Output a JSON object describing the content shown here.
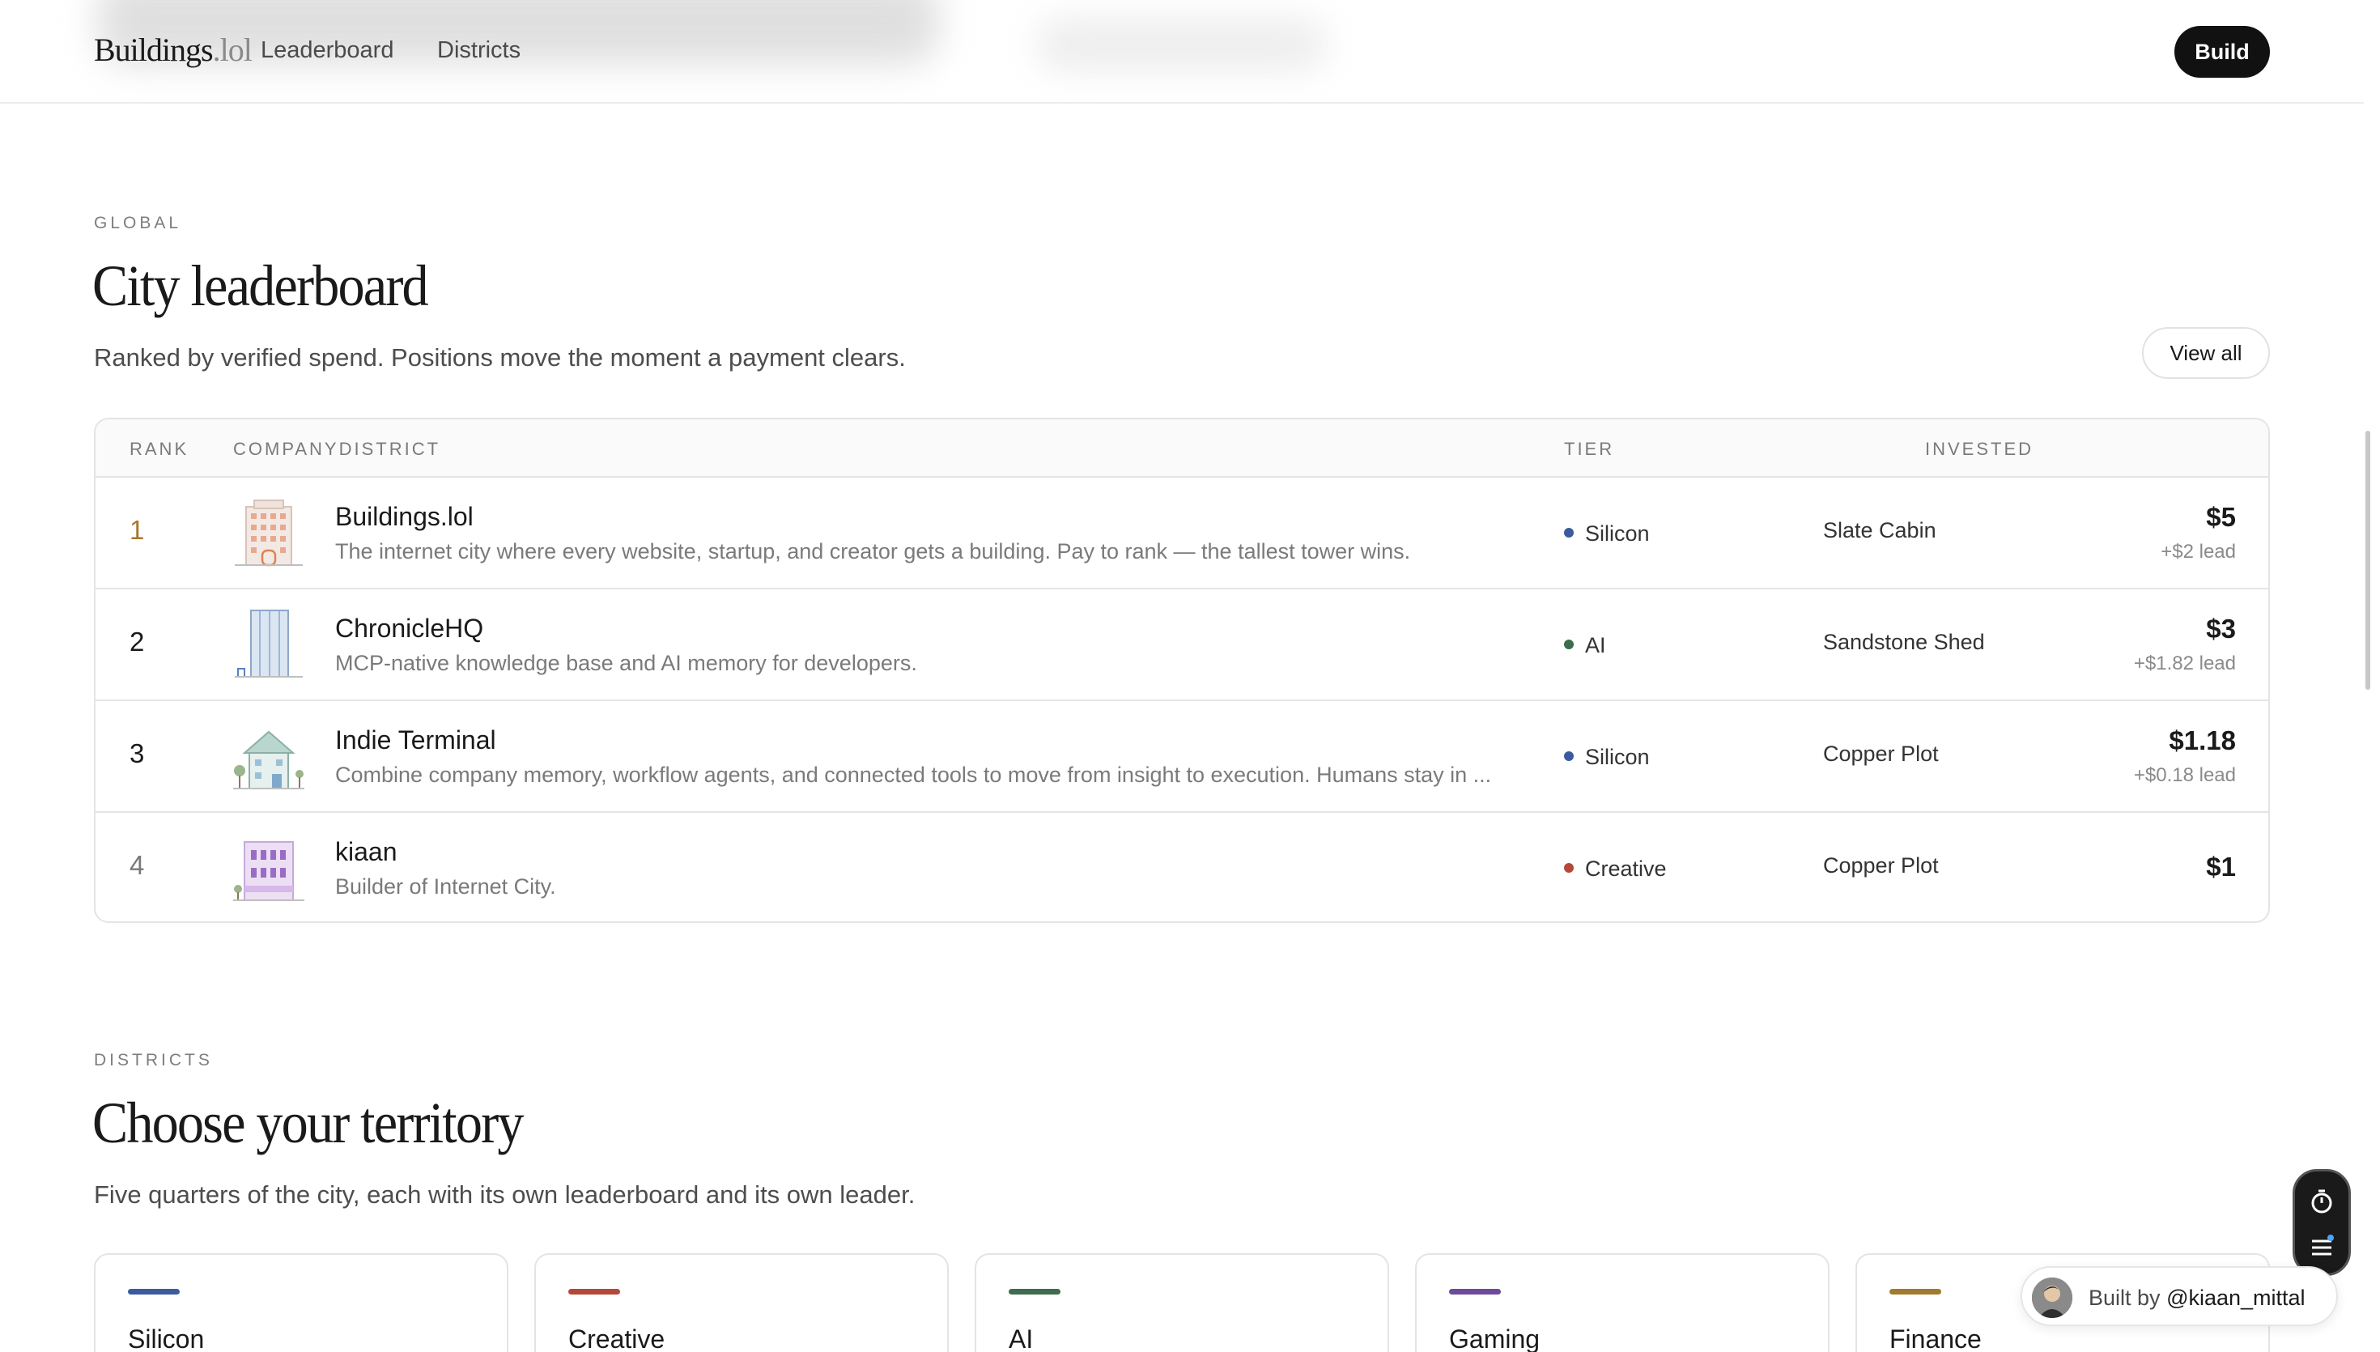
{
  "header": {
    "logo_main": "Buildings",
    "logo_tld": ".lol",
    "nav": [
      "Leaderboard",
      "Districts"
    ],
    "build_label": "Build"
  },
  "leaderboard": {
    "eyebrow": "GLOBAL",
    "title": "City leaderboard",
    "subtitle": "Ranked by verified spend. Positions move the moment a payment clears.",
    "view_all_label": "View all",
    "columns": {
      "rank": "RANK",
      "company": "COMPANYDISTRICT",
      "tier": "TIER",
      "invested": "INVESTED"
    },
    "rows": [
      {
        "rank": "1",
        "name": "Buildings.lol",
        "desc": "The internet city where every website, startup, and creator gets a building. Pay to rank — the tallest tower wins.",
        "district": "Silicon",
        "district_color": "#3d5a9e",
        "tier": "Slate Cabin",
        "amount": "$5",
        "lead": "+$2 lead"
      },
      {
        "rank": "2",
        "name": "ChronicleHQ",
        "desc": "MCP-native knowledge base and AI memory for developers.",
        "district": "AI",
        "district_color": "#3f6b4e",
        "tier": "Sandstone Shed",
        "amount": "$3",
        "lead": "+$1.82 lead"
      },
      {
        "rank": "3",
        "name": "Indie Terminal",
        "desc": "Combine company memory, workflow agents, and connected tools to move from insight to execution. Humans stay in ...",
        "district": "Silicon",
        "district_color": "#3d5a9e",
        "tier": "Copper Plot",
        "amount": "$1.18",
        "lead": "+$0.18 lead"
      },
      {
        "rank": "4",
        "name": "kiaan",
        "desc": "Builder of Internet City.",
        "district": "Creative",
        "district_color": "#b4483a",
        "tier": "Copper Plot",
        "amount": "$1",
        "lead": ""
      }
    ]
  },
  "districts": {
    "eyebrow": "DISTRICTS",
    "title": "Choose your territory",
    "subtitle": "Five quarters of the city, each with its own leaderboard and its own leader.",
    "cards": [
      {
        "name": "Silicon",
        "color": "#3d5a9e"
      },
      {
        "name": "Creative",
        "color": "#b4483a"
      },
      {
        "name": "AI",
        "color": "#3f6b4e"
      },
      {
        "name": "Gaming",
        "color": "#6e4a9a"
      },
      {
        "name": "Finance",
        "color": "#a07a2e"
      }
    ]
  },
  "widgets": {
    "built_by_prefix": "Built by",
    "built_by_handle": "@kiaan_mittal",
    "icons": [
      "timer-icon",
      "menu-icon"
    ]
  }
}
